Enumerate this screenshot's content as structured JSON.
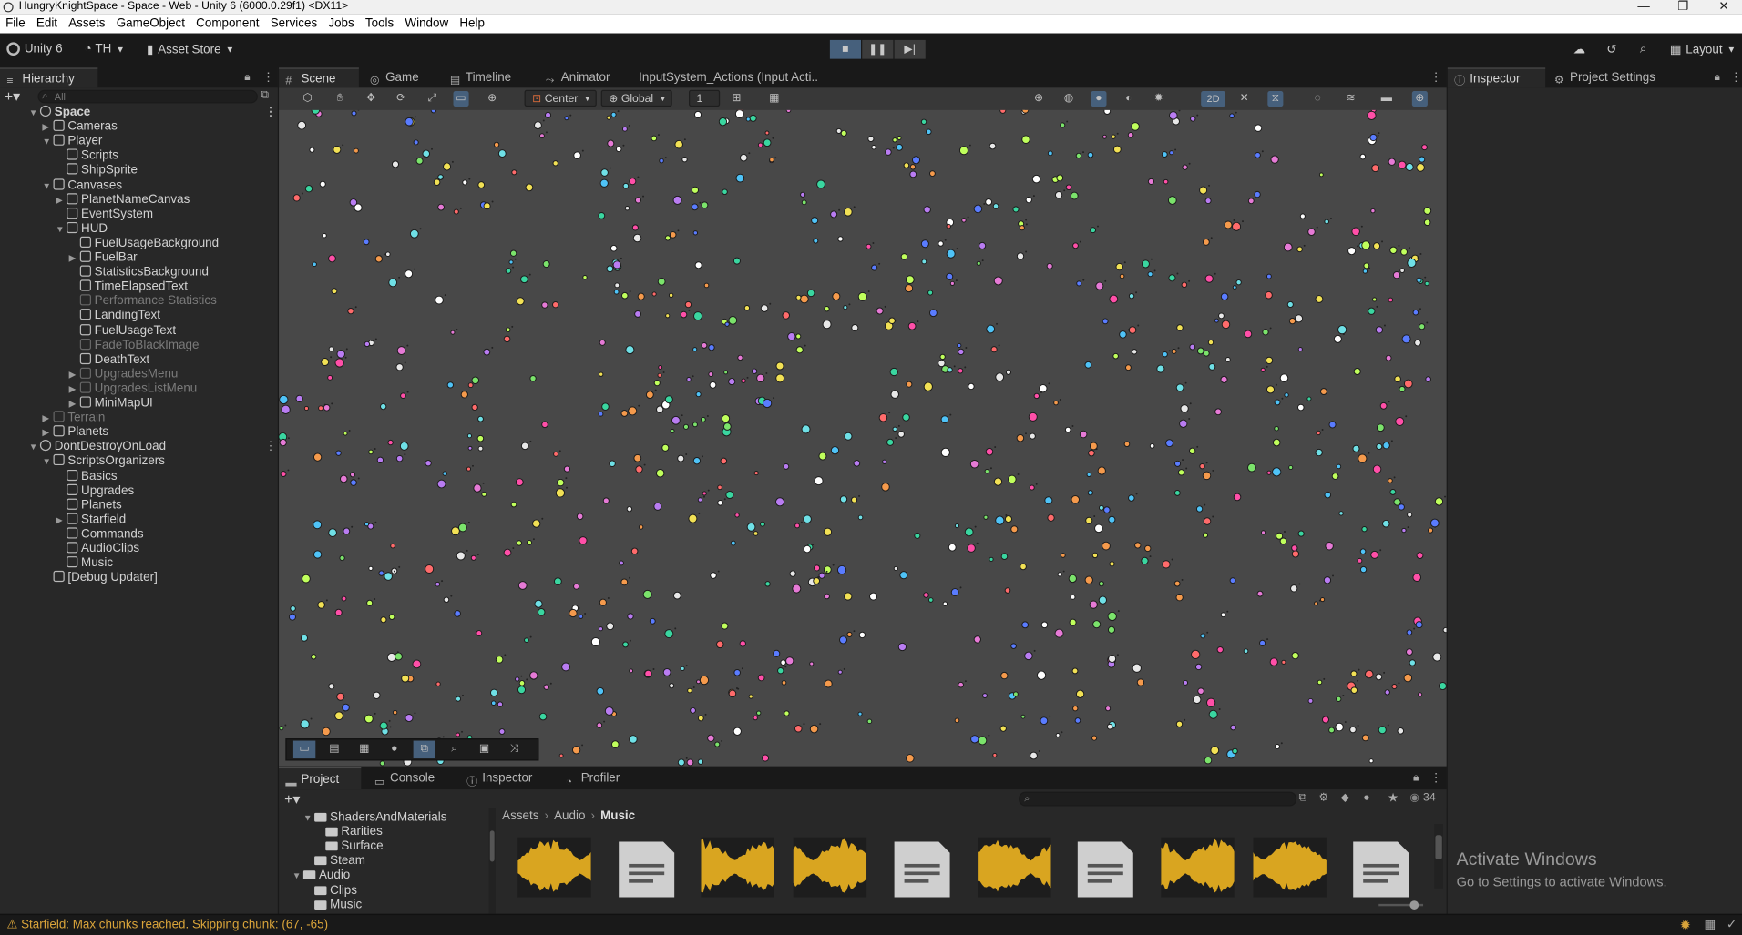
{
  "window": {
    "title": "HungryKnightSpace - Space - Web - Unity 6 (6000.0.29f1) <DX11>"
  },
  "menu": [
    "File",
    "Edit",
    "Assets",
    "GameObject",
    "Component",
    "Services",
    "Jobs",
    "Tools",
    "Window",
    "Help"
  ],
  "toolbar": {
    "unity_label": "Unity 6",
    "account": "TH",
    "asset_store": "Asset Store",
    "layout": "Layout"
  },
  "hierarchy": {
    "tab": "Hierarchy",
    "search_placeholder": "All",
    "items": [
      {
        "label": "Space",
        "depth": 0,
        "arrow": "▼",
        "bold": true,
        "scene": true
      },
      {
        "label": "Cameras",
        "depth": 1,
        "arrow": "▶"
      },
      {
        "label": "Player",
        "depth": 1,
        "arrow": "▼"
      },
      {
        "label": "Scripts",
        "depth": 2,
        "arrow": ""
      },
      {
        "label": "ShipSprite",
        "depth": 2,
        "arrow": ""
      },
      {
        "label": "Canvases",
        "depth": 1,
        "arrow": "▼"
      },
      {
        "label": "PlanetNameCanvas",
        "depth": 2,
        "arrow": "▶"
      },
      {
        "label": "EventSystem",
        "depth": 2,
        "arrow": ""
      },
      {
        "label": "HUD",
        "depth": 2,
        "arrow": "▼"
      },
      {
        "label": "FuelUsageBackground",
        "depth": 3,
        "arrow": ""
      },
      {
        "label": "FuelBar",
        "depth": 3,
        "arrow": "▶"
      },
      {
        "label": "StatisticsBackground",
        "depth": 3,
        "arrow": ""
      },
      {
        "label": "TimeElapsedText",
        "depth": 3,
        "arrow": ""
      },
      {
        "label": "Performance Statistics",
        "depth": 3,
        "arrow": "",
        "dim": true
      },
      {
        "label": "LandingText",
        "depth": 3,
        "arrow": ""
      },
      {
        "label": "FuelUsageText",
        "depth": 3,
        "arrow": ""
      },
      {
        "label": "FadeToBlackImage",
        "depth": 3,
        "arrow": "",
        "dim": true
      },
      {
        "label": "DeathText",
        "depth": 3,
        "arrow": ""
      },
      {
        "label": "UpgradesMenu",
        "depth": 3,
        "arrow": "▶",
        "dim": true
      },
      {
        "label": "UpgradesListMenu",
        "depth": 3,
        "arrow": "▶",
        "dim": true
      },
      {
        "label": "MiniMapUI",
        "depth": 3,
        "arrow": "▶"
      },
      {
        "label": "Terrain",
        "depth": 1,
        "arrow": "▶",
        "dim": true
      },
      {
        "label": "Planets",
        "depth": 1,
        "arrow": "▶"
      },
      {
        "label": "DontDestroyOnLoad",
        "depth": 0,
        "arrow": "▼",
        "scene": true
      },
      {
        "label": "ScriptsOrganizers",
        "depth": 1,
        "arrow": "▼"
      },
      {
        "label": "Basics",
        "depth": 2,
        "arrow": ""
      },
      {
        "label": "Upgrades",
        "depth": 2,
        "arrow": ""
      },
      {
        "label": "Planets",
        "depth": 2,
        "arrow": ""
      },
      {
        "label": "Starfield",
        "depth": 2,
        "arrow": "▶"
      },
      {
        "label": "Commands",
        "depth": 2,
        "arrow": ""
      },
      {
        "label": "AudioClips",
        "depth": 2,
        "arrow": ""
      },
      {
        "label": "Music",
        "depth": 2,
        "arrow": ""
      },
      {
        "label": "[Debug Updater]",
        "depth": 1,
        "arrow": ""
      }
    ]
  },
  "scene_tabs": [
    "Scene",
    "Game",
    "Timeline",
    "Animator",
    "InputSystem_Actions (Input Acti.."
  ],
  "scene_toolbar": {
    "pivot": "Center",
    "space": "Global",
    "snap": "1",
    "mode_2d": "2D"
  },
  "inspector_tabs": [
    "Inspector",
    "Project Settings"
  ],
  "bottom_tabs": [
    "Project",
    "Console",
    "Inspector",
    "Profiler"
  ],
  "project": {
    "breadcrumb": [
      "Assets",
      "Audio",
      "Music"
    ],
    "count": "34",
    "tree": [
      {
        "label": "ShadersAndMaterials",
        "depth": 1,
        "arrow": "▼"
      },
      {
        "label": "Rarities",
        "depth": 2,
        "arrow": ""
      },
      {
        "label": "Surface",
        "depth": 2,
        "arrow": ""
      },
      {
        "label": "Steam",
        "depth": 1,
        "arrow": ""
      },
      {
        "label": "Audio",
        "depth": 0,
        "arrow": "▼"
      },
      {
        "label": "Clips",
        "depth": 1,
        "arrow": ""
      },
      {
        "label": "Music",
        "depth": 1,
        "arrow": ""
      }
    ],
    "assets": [
      "wave",
      "doc",
      "wave",
      "wave",
      "doc",
      "wave",
      "doc",
      "wave",
      "wave",
      "doc"
    ]
  },
  "status": {
    "message": "Starfield: Max chunks reached. Skipping chunk: (67, -65)"
  },
  "watermark": {
    "line1": "Activate Windows",
    "line2": "Go to Settings to activate Windows."
  },
  "colors": {
    "accent": "#46607c",
    "waveform": "#d9a520",
    "warning": "#d9a43a",
    "scene_bg": "#484848"
  }
}
